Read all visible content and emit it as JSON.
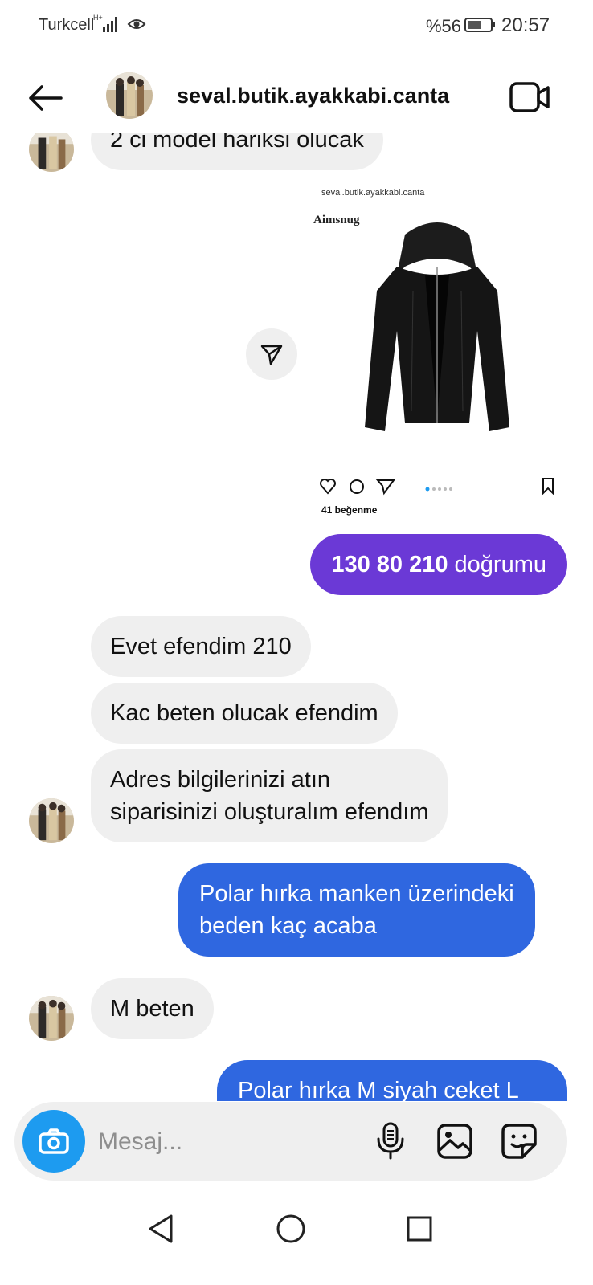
{
  "status_bar": {
    "carrier": "Turkcell",
    "network": "H+",
    "battery_percent": "%56",
    "time": "20:57"
  },
  "header": {
    "username": "seval.butik.ayakkabi.canta",
    "back_icon": "arrow-left-icon",
    "video_icon": "video-call-icon"
  },
  "post": {
    "account": "seval.butik.ayakkabi.canta",
    "brand": "Aimsnug",
    "likes": "41 beğenme"
  },
  "messages": [
    {
      "from": "them",
      "text": "2 ci model hariksi olucak"
    },
    {
      "from": "me",
      "bold": "130 80 210",
      "text": " doğrumu"
    },
    {
      "from": "them",
      "text": "Evet efendim 210"
    },
    {
      "from": "them",
      "text": "Kac beten olucak efendim"
    },
    {
      "from": "them",
      "line1": "Adres bilgilerinizi atın",
      "line2": "siparisinizi oluşturalım efendım"
    },
    {
      "from": "me",
      "line1": "Polar hırka manken üzerindeki",
      "line2": "beden kaç acaba"
    },
    {
      "from": "them",
      "text": "M beten"
    },
    {
      "from": "me",
      "text": "Polar hırka M siyah ceket L"
    }
  ],
  "composer": {
    "placeholder": "Mesaj..."
  },
  "colors": {
    "purple_bubble": "#6b39d6",
    "blue_bubble": "#2f67e0",
    "camera_button": "#1d9bf0",
    "incoming_bubble": "#efefef"
  }
}
